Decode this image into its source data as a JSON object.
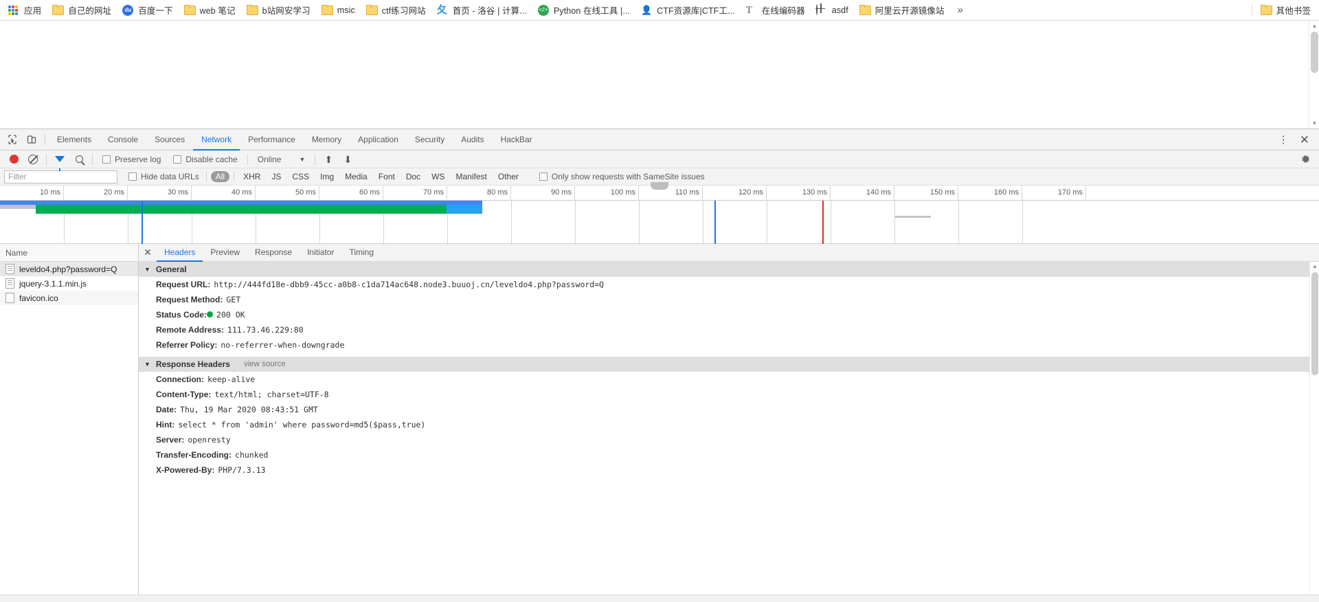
{
  "bookmarks": {
    "items": [
      {
        "label": "应用",
        "icon": "apps-grid-icon"
      },
      {
        "label": "自己的网址",
        "icon": "folder-icon"
      },
      {
        "label": "百度一下",
        "icon": "baidu-icon"
      },
      {
        "label": "web 笔记",
        "icon": "folder-icon"
      },
      {
        "label": "b站网安学习",
        "icon": "folder-icon"
      },
      {
        "label": "msic",
        "icon": "folder-icon"
      },
      {
        "label": "ctf练习网站",
        "icon": "folder-icon"
      },
      {
        "label": "首页 - 洛谷 | 计算...",
        "icon": "luogu-icon"
      },
      {
        "label": "Python 在线工具 |...",
        "icon": "python-icon"
      },
      {
        "label": "CTF资源库|CTF工...",
        "icon": "person-icon"
      },
      {
        "label": "在线编码器",
        "icon": "text-t-icon"
      },
      {
        "label": "asdf",
        "icon": "globe-icon"
      },
      {
        "label": "阿里云开源镜像站",
        "icon": "folder-icon"
      }
    ],
    "overflow_label": "»",
    "other_bookmarks": {
      "label": "其他书签",
      "icon": "folder-icon"
    }
  },
  "devtools": {
    "panel_tabs": [
      "Elements",
      "Console",
      "Sources",
      "Network",
      "Performance",
      "Memory",
      "Application",
      "Security",
      "Audits",
      "HackBar"
    ],
    "active_panel": "Network",
    "inspect_icon": "inspect-cursor-icon",
    "device_icon": "device-toolbar-icon",
    "more_icon": "more-vertical-icon",
    "close_icon": "close-icon",
    "network_toolbar": {
      "record_icon": "record-circle-icon",
      "clear_icon": "clear-no-entry-icon",
      "filter_icon": "funnel-filter-icon",
      "search_icon": "search-magnifier-icon",
      "preserve_log": {
        "label": "Preserve log",
        "checked": false
      },
      "disable_cache": {
        "label": "Disable cache",
        "checked": false
      },
      "throttling": {
        "value": "Online",
        "caret": "▼"
      },
      "import_icon": "import-arrow-up-icon",
      "export_icon": "export-arrow-down-icon",
      "settings_icon": "gear-icon"
    },
    "filter_bar": {
      "filter_placeholder": "Filter",
      "filter_value": "",
      "hide_data_urls": {
        "label": "Hide data URLs",
        "checked": false
      },
      "types": [
        "All",
        "XHR",
        "JS",
        "CSS",
        "Img",
        "Media",
        "Font",
        "Doc",
        "WS",
        "Manifest",
        "Other"
      ],
      "active_type": "All",
      "samesite": {
        "label": "Only show requests with SameSite issues",
        "checked": false
      }
    },
    "overview": {
      "ticks": [
        "10 ms",
        "20 ms",
        "30 ms",
        "40 ms",
        "50 ms",
        "60 ms",
        "70 ms",
        "80 ms",
        "90 ms",
        "100 ms",
        "110 ms",
        "120 ms",
        "130 ms",
        "140 ms",
        "150 ms",
        "160 ms",
        "170 ms"
      ]
    },
    "request_list": {
      "column_header": "Name",
      "rows": [
        {
          "name": "leveldo4.php?password=Q",
          "icon": "document-icon",
          "selected": true
        },
        {
          "name": "jquery-3.1.1.min.js",
          "icon": "document-icon",
          "selected": false
        },
        {
          "name": "favicon.ico",
          "icon": "file-icon",
          "selected": false
        }
      ]
    },
    "detail": {
      "tabs": [
        "Headers",
        "Preview",
        "Response",
        "Initiator",
        "Timing"
      ],
      "active_tab": "Headers",
      "close_icon": "close-icon",
      "general": {
        "title": "General",
        "rows": [
          {
            "key": "Request URL:",
            "value": "http://444fd18e-dbb9-45cc-a0b8-c1da714ac648.node3.buuoj.cn/leveldo4.php?password=Q"
          },
          {
            "key": "Request Method:",
            "value": "GET"
          },
          {
            "key": "Status Code:",
            "value": "200 OK",
            "status_color": "#00a63f"
          },
          {
            "key": "Remote Address:",
            "value": "111.73.46.229:80"
          },
          {
            "key": "Referrer Policy:",
            "value": "no-referrer-when-downgrade"
          }
        ]
      },
      "response_headers": {
        "title": "Response Headers",
        "view_source": "view source",
        "rows": [
          {
            "key": "Connection:",
            "value": "keep-alive"
          },
          {
            "key": "Content-Type:",
            "value": "text/html; charset=UTF-8"
          },
          {
            "key": "Date:",
            "value": "Thu, 19 Mar 2020 08:43:51 GMT"
          },
          {
            "key": "Hint:",
            "value": "select * from 'admin' where password=md5($pass,true)"
          },
          {
            "key": "Server:",
            "value": "openresty"
          },
          {
            "key": "Transfer-Encoding:",
            "value": "chunked"
          },
          {
            "key": "X-Powered-By:",
            "value": "PHP/7.3.13"
          }
        ]
      }
    }
  },
  "colors": {
    "accent": "#1a73e8",
    "record": "#e3342f",
    "status_ok": "#00a63f",
    "band_green": "#00b050",
    "band_blue": "#4285f4",
    "band_cyan": "#28a1f2",
    "event_red": "#d93025"
  }
}
